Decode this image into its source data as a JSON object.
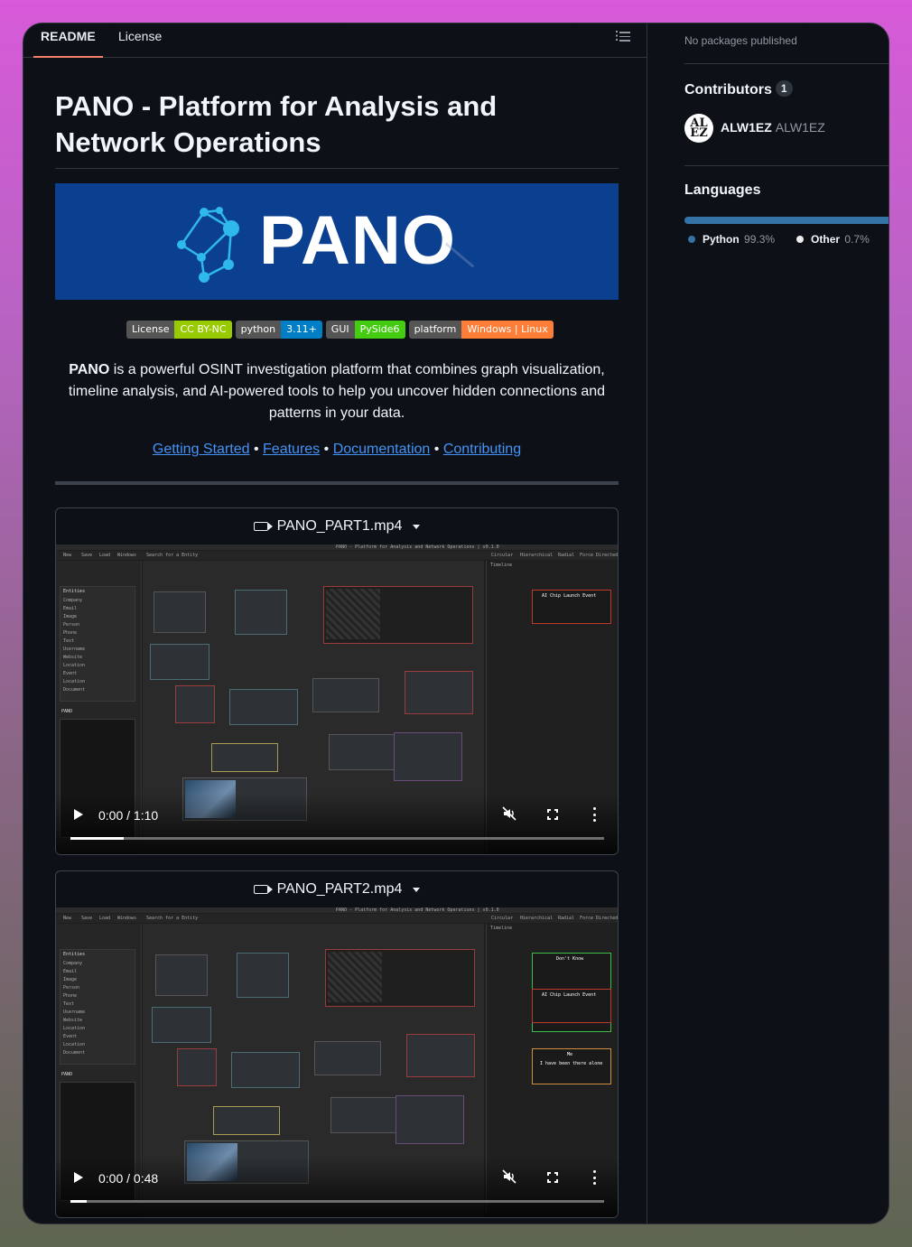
{
  "tabs": [
    {
      "label": "README",
      "active": true
    },
    {
      "label": "License",
      "active": false
    }
  ],
  "readme": {
    "title": "PANO - Platform for Analysis and Network Operations",
    "banner_text": "PANO",
    "badges": [
      {
        "label": "License",
        "value": "CC BY-NC",
        "color": "#97ca00"
      },
      {
        "label": "python",
        "value": "3.11+",
        "color": "#007ec6"
      },
      {
        "label": "GUI",
        "value": "PySide6",
        "color": "#4c1"
      },
      {
        "label": "platform",
        "value": "Windows | Linux",
        "color": "#fe7d37"
      }
    ],
    "intro_bold": "PANO",
    "intro_rest": " is a powerful OSINT investigation platform that combines graph visualization, timeline analysis, and AI-powered tools to help you uncover hidden connections and patterns in your data.",
    "links": [
      "Getting Started",
      "Features",
      "Documentation",
      "Contributing"
    ],
    "link_separator": "•"
  },
  "videos": [
    {
      "filename": "PANO_PART1.mp4",
      "time": "0:00 / 1:10",
      "progress": 0.1
    },
    {
      "filename": "PANO_PART2.mp4",
      "time": "0:00 / 0:48",
      "progress": 0.03
    }
  ],
  "app_ui": {
    "window_title": "PANO - Platform for Analysis and Network Operations | v0.1.0",
    "toolbar": [
      "New",
      "Save",
      "Load",
      "Windows",
      "Search for a Entity"
    ],
    "view_tabs": [
      "Circular",
      "Hierarchical",
      "Radial",
      "Force Directed"
    ],
    "entities_header": "Entities",
    "entity_types": [
      "Company",
      "Email",
      "Image",
      "Person",
      "Phone",
      "Text",
      "Username",
      "Website",
      "Location",
      "Event",
      "Location",
      "Document"
    ],
    "panel_header": "PANO",
    "timeline_label": "Timeline",
    "events": [
      "AI Chip Launch Event",
      "Don't Know",
      "Me",
      "I have been there alone"
    ]
  },
  "sidebar": {
    "packages_text": "No packages published",
    "contributors_heading": "Contributors",
    "contributors_count": "1",
    "contributor_login": "ALW1EZ",
    "contributor_name": "ALW1EZ",
    "contributor_avatar_text": "AL EZ",
    "languages_heading": "Languages",
    "languages": [
      {
        "name": "Python",
        "percent": "99.3%",
        "color": "#3572A5"
      },
      {
        "name": "Other",
        "percent": "0.7%",
        "color": "#ededed"
      }
    ]
  }
}
